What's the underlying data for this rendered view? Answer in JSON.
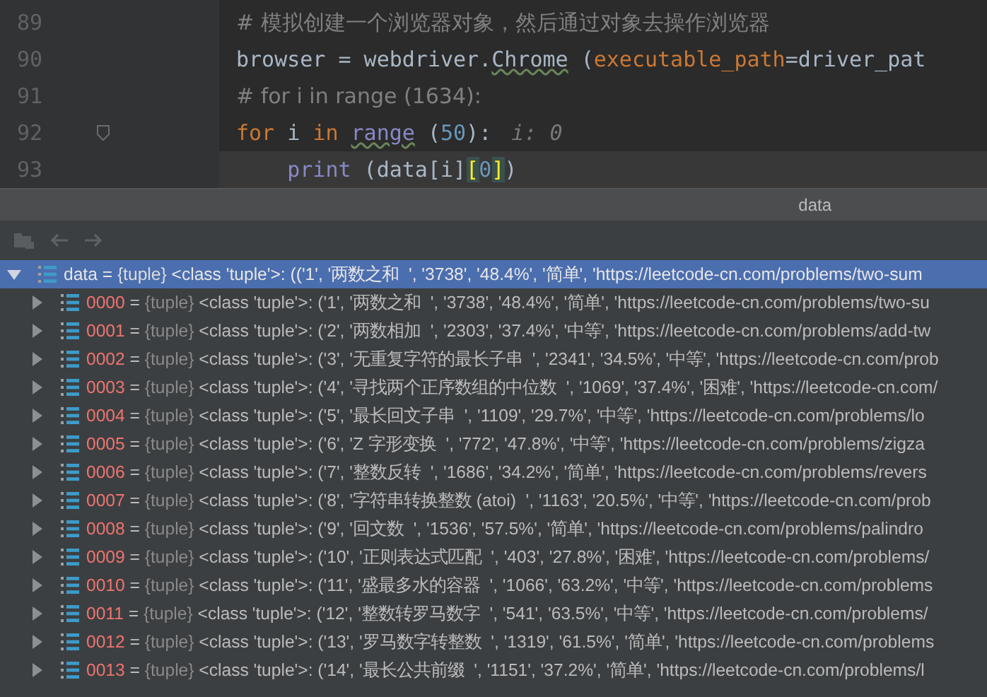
{
  "editor": {
    "lines": [
      {
        "number": "89",
        "fold": false,
        "current": false,
        "tokens": [
          {
            "text": "# 模拟创建一个浏览器对象，然后通过对象去操作浏览器",
            "kind": "comment"
          }
        ]
      },
      {
        "number": "90",
        "fold": false,
        "current": false,
        "tokens": [
          {
            "text": "browser = webdriver.",
            "kind": "plain"
          },
          {
            "text": "Chrome",
            "kind": "warn"
          },
          {
            "text": " (",
            "kind": "plain"
          },
          {
            "text": "executable_path",
            "kind": "param"
          },
          {
            "text": "=driver_pat",
            "kind": "plain"
          }
        ]
      },
      {
        "number": "91",
        "fold": false,
        "current": false,
        "tokens": [
          {
            "text": "# for i in range (1634):",
            "kind": "comment"
          }
        ]
      },
      {
        "number": "92",
        "fold": true,
        "current": false,
        "tokens": [
          {
            "text": "for",
            "kind": "keyword"
          },
          {
            "text": " i ",
            "kind": "plain"
          },
          {
            "text": "in",
            "kind": "keyword"
          },
          {
            "text": "range",
            "kind": "builtinwarn"
          },
          {
            "text": " (",
            "kind": "plain"
          },
          {
            "text": "50",
            "kind": "number"
          },
          {
            "text": "):",
            "kind": "plain"
          },
          {
            "text": "i: 0",
            "kind": "hint"
          }
        ]
      },
      {
        "number": "93",
        "fold": false,
        "current": true,
        "indented": true,
        "tokens": [
          {
            "text": "print",
            "kind": "builtin"
          },
          {
            "text": " (data[i]",
            "kind": "plain"
          },
          {
            "text": "[",
            "kind": "brace"
          },
          {
            "text": "0",
            "kind": "number"
          },
          {
            "text": "]",
            "kind": "brace"
          },
          {
            "text": ")",
            "kind": "plain"
          }
        ]
      }
    ]
  },
  "panel": {
    "title": "data"
  },
  "tree": {
    "separator": "=",
    "root": {
      "name": "data",
      "type": "{tuple}",
      "value": "<class 'tuple'>: (('1', '两数之和  ', '3738', '48.4%', '简单', 'https://leetcode-cn.com/problems/two-sum",
      "selected": true,
      "expanded": true
    },
    "children": [
      {
        "name": "0000",
        "type": "{tuple}",
        "value": "<class 'tuple'>: ('1', '两数之和  ', '3738', '48.4%', '简单', 'https://leetcode-cn.com/problems/two-su",
        "selected": false,
        "expanded": false
      },
      {
        "name": "0001",
        "type": "{tuple}",
        "value": "<class 'tuple'>: ('2', '两数相加  ', '2303', '37.4%', '中等', 'https://leetcode-cn.com/problems/add-tw",
        "selected": false,
        "expanded": false
      },
      {
        "name": "0002",
        "type": "{tuple}",
        "value": "<class 'tuple'>: ('3', '无重复字符的最长子串  ', '2341', '34.5%', '中等', 'https://leetcode-cn.com/prob",
        "selected": false,
        "expanded": false
      },
      {
        "name": "0003",
        "type": "{tuple}",
        "value": "<class 'tuple'>: ('4', '寻找两个正序数组的中位数  ', '1069', '37.4%', '困难', 'https://leetcode-cn.com/",
        "selected": false,
        "expanded": false
      },
      {
        "name": "0004",
        "type": "{tuple}",
        "value": "<class 'tuple'>: ('5', '最长回文子串  ', '1109', '29.7%', '中等', 'https://leetcode-cn.com/problems/lo",
        "selected": false,
        "expanded": false
      },
      {
        "name": "0005",
        "type": "{tuple}",
        "value": "<class 'tuple'>: ('6', 'Z 字形变换  ', '772', '47.8%', '中等', 'https://leetcode-cn.com/problems/zigza",
        "selected": false,
        "expanded": false
      },
      {
        "name": "0006",
        "type": "{tuple}",
        "value": "<class 'tuple'>: ('7', '整数反转  ', '1686', '34.2%', '简单', 'https://leetcode-cn.com/problems/revers",
        "selected": false,
        "expanded": false
      },
      {
        "name": "0007",
        "type": "{tuple}",
        "value": "<class 'tuple'>: ('8', '字符串转换整数 (atoi)  ', '1163', '20.5%', '中等', 'https://leetcode-cn.com/prob",
        "selected": false,
        "expanded": false
      },
      {
        "name": "0008",
        "type": "{tuple}",
        "value": "<class 'tuple'>: ('9', '回文数  ', '1536', '57.5%', '简单', 'https://leetcode-cn.com/problems/palindro",
        "selected": false,
        "expanded": false
      },
      {
        "name": "0009",
        "type": "{tuple}",
        "value": "<class 'tuple'>: ('10', '正则表达式匹配  ', '403', '27.8%', '困难', 'https://leetcode-cn.com/problems/",
        "selected": false,
        "expanded": false
      },
      {
        "name": "0010",
        "type": "{tuple}",
        "value": "<class 'tuple'>: ('11', '盛最多水的容器  ', '1066', '63.2%', '中等', 'https://leetcode-cn.com/problems",
        "selected": false,
        "expanded": false
      },
      {
        "name": "0011",
        "type": "{tuple}",
        "value": "<class 'tuple'>: ('12', '整数转罗马数字  ', '541', '63.5%', '中等', 'https://leetcode-cn.com/problems/",
        "selected": false,
        "expanded": false
      },
      {
        "name": "0012",
        "type": "{tuple}",
        "value": "<class 'tuple'>: ('13', '罗马数字转整数  ', '1319', '61.5%', '简单', 'https://leetcode-cn.com/problems",
        "selected": false,
        "expanded": false
      },
      {
        "name": "0013",
        "type": "{tuple}",
        "value": "<class 'tuple'>: ('14', '最长公共前缀  ', '1151', '37.2%', '简单', 'https://leetcode-cn.com/problems/l",
        "selected": false,
        "expanded": false
      }
    ]
  }
}
